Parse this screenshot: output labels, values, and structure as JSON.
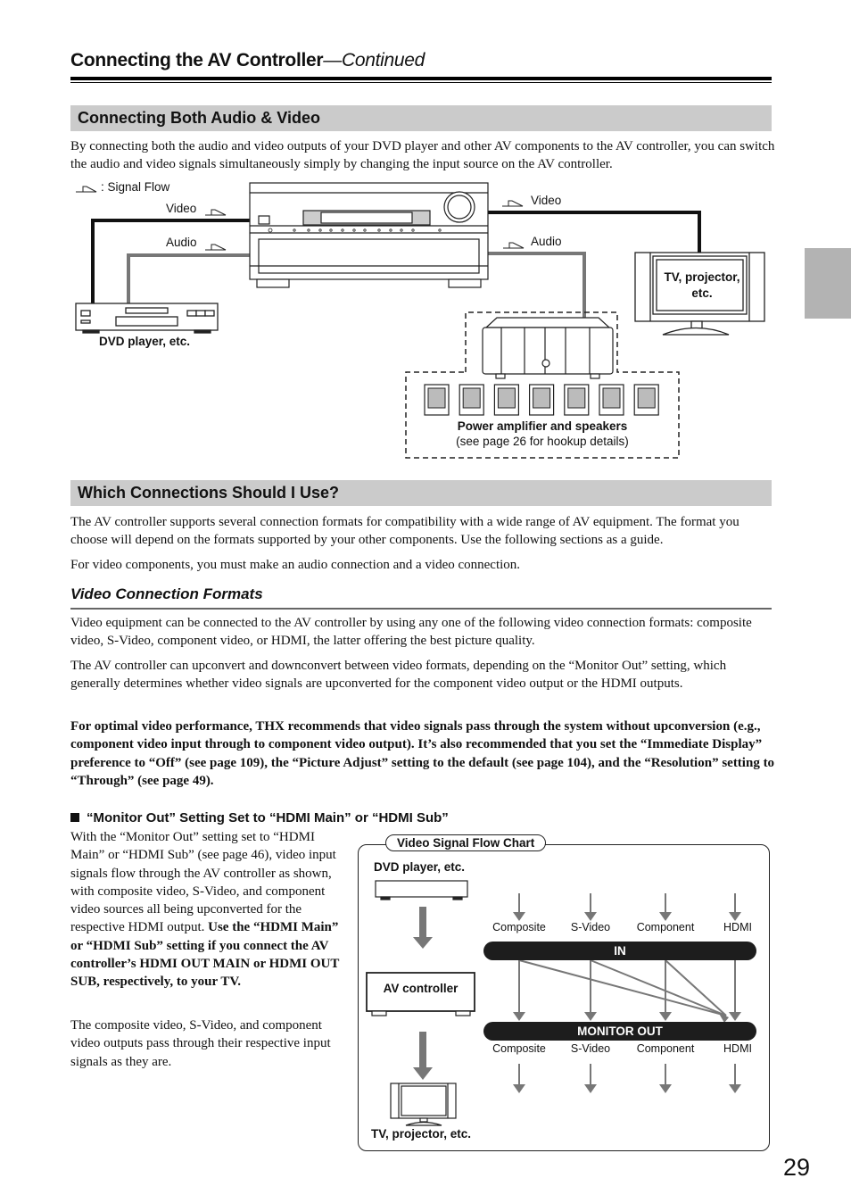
{
  "header": {
    "title": "Connecting the AV Controller",
    "title_suffix": "—Continued"
  },
  "sections": {
    "both": {
      "heading": "Connecting Both Audio & Video",
      "intro": "By connecting both the audio and video outputs of your DVD player and other AV components to the AV controller, you can switch the audio and video signals simultaneously simply by changing the input source on the AV controller."
    },
    "which": {
      "heading": "Which Connections Should I Use?",
      "p1": "The AV controller supports several connection formats for compatibility with a wide range of AV equipment. The format you choose will depend on the formats supported by your other components. Use the following sections as a guide.",
      "p2": "For video components, you must make an audio connection and a video connection."
    },
    "video_formats": {
      "heading": "Video Connection Formats",
      "p1": "Video equipment can be connected to the AV controller by using any one of the following video connection formats: composite video, S-Video, component video, or HDMI, the latter offering the best picture quality.",
      "p2": "The AV controller can upconvert and downconvert between video formats, depending on the “Monitor Out” setting, which generally determines whether video signals are upconverted for the component video output or the HDMI outputs.",
      "p3_bold": "For optimal video performance, THX recommends that video signals pass through the system without upconversion (e.g., component video input through to component video output). It’s also recommended that you set the “Immediate Display” preference to “Off” (see page 109), the “Picture Adjust” setting to the default (see page 104), and the “Resolution” setting to “Through” (see page 49)."
    },
    "monitor_out": {
      "heading": "“Monitor Out” Setting Set to “HDMI Main” or “HDMI Sub”",
      "p1_normal": "With the “Monitor Out” setting set to “HDMI Main” or “HDMI Sub” (see page 46), video input signals flow through the AV controller as shown, with composite video, S-Video, and component video sources all being upconverted for the respective HDMI output. ",
      "p1_bold": "Use the “HDMI Main” or “HDMI Sub” setting if you connect the AV controller’s HDMI OUT MAIN or HDMI OUT SUB, respectively, to your TV.",
      "p2": "The composite video, S-Video, and component video outputs pass through their respective input signals as they are."
    }
  },
  "diagram1": {
    "legend": ": Signal Flow",
    "video_left": "Video",
    "audio_left": "Audio",
    "video_right": "Video",
    "audio_right": "Audio",
    "dvd_label": "DVD player, etc.",
    "tv_label_1": "TV, projector,",
    "tv_label_2": "etc.",
    "amp_label": "Power amplifier and speakers",
    "amp_sub": "(see page 26 for hookup details)",
    "speaker_count": 7
  },
  "flowchart": {
    "title": "Video Signal Flow Chart",
    "dvd_label": "DVD player, etc.",
    "av_label": "AV controller",
    "tv_label": "TV, projector, etc.",
    "in_label": "IN",
    "out_label": "MONITOR OUT",
    "inputs": [
      "Composite",
      "S-Video",
      "Component",
      "HDMI"
    ],
    "outputs": [
      "Composite",
      "S-Video",
      "Component",
      "HDMI"
    ]
  },
  "page_number": "29"
}
